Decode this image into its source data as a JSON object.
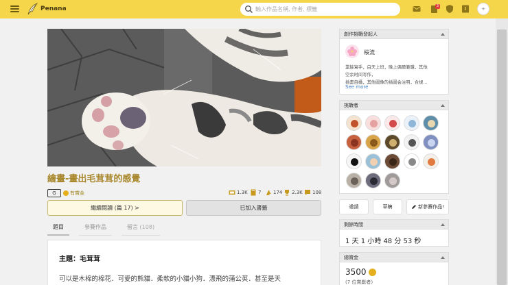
{
  "header": {
    "brand": "Penana",
    "search_placeholder": "輸入作品名稱, 作者, 標籤",
    "notification_count": "3"
  },
  "story": {
    "title": "繪畫-畫出毛茸茸的感覺",
    "rating_tag": "G",
    "prize_label": "有賞金",
    "stats": {
      "views": "1.3K",
      "chapters": "7",
      "likes": "174",
      "comments": "2.3K",
      "reviews": "108"
    },
    "continue_button": "繼續閱讀 (篇 17) >",
    "shelf_button": "已加入書籤",
    "tabs": [
      {
        "label": "題目",
        "count": ""
      },
      {
        "label": "參賽作品",
        "count": ""
      },
      {
        "label": "留言",
        "count": "(108)"
      }
    ],
    "content_heading": "主題：毛茸茸",
    "content_paragraph": "可以是木棉的棉花．可愛的熊貓．柔軟的小貓小狗．漂飛的蒲公英．甚至是天"
  },
  "sidebar": {
    "initiator": {
      "heading": "創作挑戰發起人",
      "name": "桜流",
      "bio_line1": "業餘寫手，白天上班，晚上偶爾兼職，其他",
      "bio_line2": "空余时间写作，",
      "bio_line3": "插畫自攝，其他圖像的插圖会注明，合規...",
      "see_more": "See more"
    },
    "challengers": {
      "heading": "挑戰者",
      "avatars": [
        "avatar-girl-icon",
        "avatar-cat-icon",
        "avatar-face-icon",
        "avatar-bird-icon",
        "avatar-landscape-icon",
        "avatar-octopus-icon",
        "avatar-animal-icon",
        "avatar-dark-icon",
        "avatar-sketch-icon",
        "avatar-blue-icon",
        "avatar-urchin-icon",
        "avatar-anime-icon",
        "avatar-brown-icon",
        "avatar-text-icon",
        "avatar-cake-icon",
        "avatar-pet-icon",
        "avatar-person-icon",
        "avatar-gray-icon"
      ]
    },
    "actions": {
      "invite": "邀請",
      "draft": "草稿",
      "new_entry": "新參賽作品!"
    },
    "countdown": {
      "heading": "剩餘時間",
      "value": "1 天 1 小時 48 分 53 秒"
    },
    "prize": {
      "heading": "總賞金",
      "amount": "3500",
      "sub": "(7 位賞獻者)"
    }
  },
  "colors": {
    "header_bg": "#f5d54a",
    "title_gold": "#a8862a",
    "link_blue": "#3a7bc8"
  }
}
